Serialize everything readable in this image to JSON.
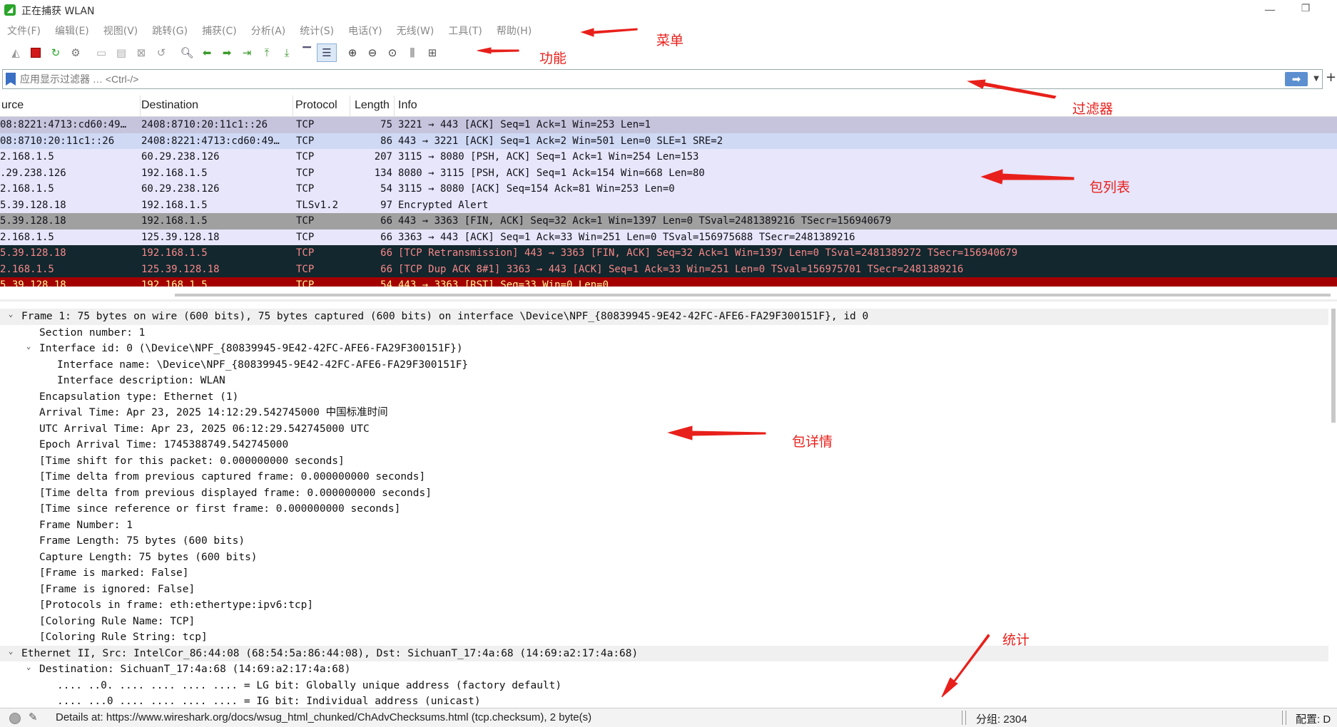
{
  "window": {
    "title": "正在捕获 WLAN",
    "min_symbol": "—",
    "max_symbol": "❐"
  },
  "menu": [
    "文件(F)",
    "编辑(E)",
    "视图(V)",
    "跳转(G)",
    "捕获(C)",
    "分析(A)",
    "统计(S)",
    "电话(Y)",
    "无线(W)",
    "工具(T)",
    "帮助(H)"
  ],
  "toolbar": {
    "icons": [
      "shark-fin-start-icon",
      "stop-capture-icon",
      "restart-capture-icon",
      "capture-options-icon",
      "open-file-icon",
      "save-file-icon",
      "close-file-icon",
      "reload-file-icon",
      "find-packet-icon",
      "go-back-icon",
      "go-forward-icon",
      "go-to-packet-icon",
      "go-first-icon",
      "go-last-icon",
      "autoscroll-icon",
      "colorize-icon",
      "zoom-in-icon",
      "zoom-out-icon",
      "zoom-normal-icon",
      "resize-columns-icon",
      "layout-icon"
    ]
  },
  "filter": {
    "placeholder": "应用显示过滤器 … <Ctrl-/>",
    "apply_symbol": "➡",
    "dropdown_symbol": "▼",
    "add_symbol": "+"
  },
  "packet_list": {
    "columns": [
      "urce",
      "Destination",
      "Protocol",
      "Length",
      "Info"
    ],
    "rows": [
      {
        "src": "08:8221:4713:cd60:49…",
        "dst": "2408:8710:20:11c1::26",
        "proto": "TCP",
        "len": "75",
        "info": "3221 → 443 [ACK] Seq=1 Ack=1 Win=253 Len=1",
        "bg": "#c6c4dd",
        "fg": "#12121a"
      },
      {
        "src": "08:8710:20:11c1::26",
        "dst": "2408:8221:4713:cd60:49…",
        "proto": "TCP",
        "len": "86",
        "info": "443 → 3221 [ACK] Seq=1 Ack=2 Win=501 Len=0 SLE=1 SRE=2",
        "bg": "#cfd9f4",
        "fg": "#12121a"
      },
      {
        "src": "2.168.1.5",
        "dst": "60.29.238.126",
        "proto": "TCP",
        "len": "207",
        "info": "3115 → 8080 [PSH, ACK] Seq=1 Ack=1 Win=254 Len=153",
        "bg": "#e7e6fb",
        "fg": "#12121a"
      },
      {
        "src": ".29.238.126",
        "dst": "192.168.1.5",
        "proto": "TCP",
        "len": "134",
        "info": "8080 → 3115 [PSH, ACK] Seq=1 Ack=154 Win=668 Len=80",
        "bg": "#e7e6fb",
        "fg": "#12121a"
      },
      {
        "src": "2.168.1.5",
        "dst": "60.29.238.126",
        "proto": "TCP",
        "len": "54",
        "info": "3115 → 8080 [ACK] Seq=154 Ack=81 Win=253 Len=0",
        "bg": "#e7e6fb",
        "fg": "#12121a"
      },
      {
        "src": "5.39.128.18",
        "dst": "192.168.1.5",
        "proto": "TLSv1.2",
        "len": "97",
        "info": "Encrypted Alert",
        "bg": "#e7e6fb",
        "fg": "#12121a"
      },
      {
        "src": "5.39.128.18",
        "dst": "192.168.1.5",
        "proto": "TCP",
        "len": "66",
        "info": "443 → 3363 [FIN, ACK] Seq=32 Ack=1 Win=1397 Len=0 TSval=2481389216 TSecr=156940679",
        "bg": "#a0a0a0",
        "fg": "#12121a"
      },
      {
        "src": "2.168.1.5",
        "dst": "125.39.128.18",
        "proto": "TCP",
        "len": "66",
        "info": "3363 → 443 [ACK] Seq=1 Ack=33 Win=251 Len=0 TSval=156975688 TSecr=2481389216",
        "bg": "#e7e6fb",
        "fg": "#12121a"
      },
      {
        "src": "5.39.128.18",
        "dst": "192.168.1.5",
        "proto": "TCP",
        "len": "66",
        "info": "[TCP Retransmission] 443 → 3363 [FIN, ACK] Seq=32 Ack=1 Win=1397 Len=0 TSval=2481389272 TSecr=156940679",
        "bg": "#12272e",
        "fg": "#f78787"
      },
      {
        "src": "2.168.1.5",
        "dst": "125.39.128.18",
        "proto": "TCP",
        "len": "66",
        "info": "[TCP Dup ACK 8#1] 3363 → 443 [ACK] Seq=1 Ack=33 Win=251 Len=0 TSval=156975701 TSecr=2481389216",
        "bg": "#12272e",
        "fg": "#f78787"
      },
      {
        "src": "5.39.128.18",
        "dst": "192.168.1.5",
        "proto": "TCP",
        "len": "54",
        "info": "443 → 3363 [RST] Seq=33 Win=0 Len=0",
        "bg": "#a40000",
        "fg": "#fffc9c"
      }
    ]
  },
  "details": [
    {
      "indent": 0,
      "arrow": "⌄",
      "top": true,
      "text": "Frame 1: 75 bytes on wire (600 bits), 75 bytes captured (600 bits) on interface \\Device\\NPF_{80839945-9E42-42FC-AFE6-FA29F300151F}, id 0"
    },
    {
      "indent": 1,
      "arrow": "",
      "text": "Section number: 1"
    },
    {
      "indent": 1,
      "arrow": "⌄",
      "text": "Interface id: 0 (\\Device\\NPF_{80839945-9E42-42FC-AFE6-FA29F300151F})"
    },
    {
      "indent": 2,
      "arrow": "",
      "text": "Interface name: \\Device\\NPF_{80839945-9E42-42FC-AFE6-FA29F300151F}"
    },
    {
      "indent": 2,
      "arrow": "",
      "text": "Interface description: WLAN"
    },
    {
      "indent": 1,
      "arrow": "",
      "text": "Encapsulation type: Ethernet (1)"
    },
    {
      "indent": 1,
      "arrow": "",
      "text": "Arrival Time: Apr 23, 2025 14:12:29.542745000 中国标准时间"
    },
    {
      "indent": 1,
      "arrow": "",
      "text": "UTC Arrival Time: Apr 23, 2025 06:12:29.542745000 UTC"
    },
    {
      "indent": 1,
      "arrow": "",
      "text": "Epoch Arrival Time: 1745388749.542745000"
    },
    {
      "indent": 1,
      "arrow": "",
      "text": "[Time shift for this packet: 0.000000000 seconds]"
    },
    {
      "indent": 1,
      "arrow": "",
      "text": "[Time delta from previous captured frame: 0.000000000 seconds]"
    },
    {
      "indent": 1,
      "arrow": "",
      "text": "[Time delta from previous displayed frame: 0.000000000 seconds]"
    },
    {
      "indent": 1,
      "arrow": "",
      "text": "[Time since reference or first frame: 0.000000000 seconds]"
    },
    {
      "indent": 1,
      "arrow": "",
      "text": "Frame Number: 1"
    },
    {
      "indent": 1,
      "arrow": "",
      "text": "Frame Length: 75 bytes (600 bits)"
    },
    {
      "indent": 1,
      "arrow": "",
      "text": "Capture Length: 75 bytes (600 bits)"
    },
    {
      "indent": 1,
      "arrow": "",
      "text": "[Frame is marked: False]"
    },
    {
      "indent": 1,
      "arrow": "",
      "text": "[Frame is ignored: False]"
    },
    {
      "indent": 1,
      "arrow": "",
      "text": "[Protocols in frame: eth:ethertype:ipv6:tcp]"
    },
    {
      "indent": 1,
      "arrow": "",
      "text": "[Coloring Rule Name: TCP]"
    },
    {
      "indent": 1,
      "arrow": "",
      "text": "[Coloring Rule String: tcp]"
    },
    {
      "indent": 0,
      "arrow": "⌄",
      "top": true,
      "text": "Ethernet II, Src: IntelCor_86:44:08 (68:54:5a:86:44:08), Dst: SichuanT_17:4a:68 (14:69:a2:17:4a:68)"
    },
    {
      "indent": 1,
      "arrow": "⌄",
      "text": "Destination: SichuanT_17:4a:68 (14:69:a2:17:4a:68)"
    },
    {
      "indent": 2,
      "arrow": "",
      "text": ".... ..0. .... .... .... .... = LG bit: Globally unique address (factory default)"
    },
    {
      "indent": 2,
      "arrow": "",
      "text": ".... ...0 .... .... .... .... = IG bit: Individual address (unicast)"
    }
  ],
  "statusbar": {
    "details_text": "Details at: https://www.wireshark.org/docs/wsug_html_chunked/ChAdvChecksums.html (tcp.checksum), 2 byte(s)",
    "packets_text": "分组: 2304",
    "profile_text": "配置: D"
  },
  "annotations": {
    "menu": "菜单",
    "toolbar": "功能",
    "filter": "过滤器",
    "packet_list": "包列表",
    "details": "包详情",
    "stats": "统计",
    "color": "#e8201b"
  }
}
